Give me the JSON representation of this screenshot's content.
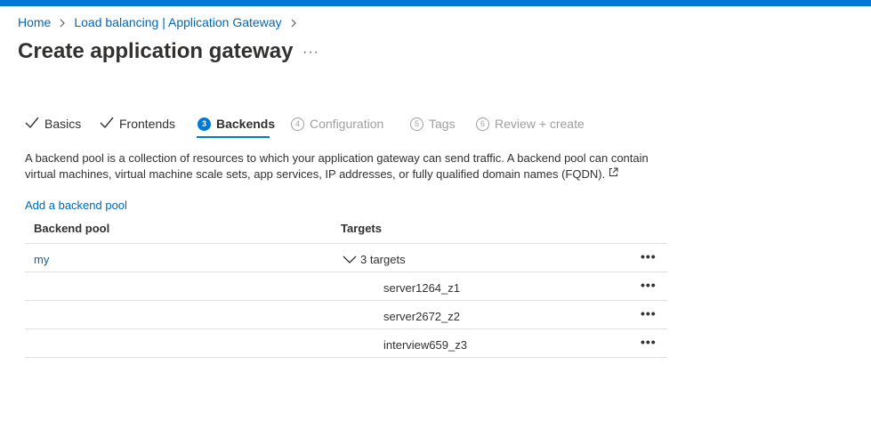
{
  "breadcrumb": {
    "items": [
      "Home",
      "Load balancing | Application Gateway"
    ]
  },
  "page": {
    "title": "Create application gateway",
    "more": "···"
  },
  "tabs": [
    {
      "label": "Basics",
      "state": "done",
      "icon": "checkmark-icon"
    },
    {
      "label": "Frontends",
      "state": "done",
      "icon": "checkmark-icon"
    },
    {
      "label": "Backends",
      "state": "active",
      "number": "3"
    },
    {
      "label": "Configuration",
      "state": "disabled",
      "number": "4"
    },
    {
      "label": "Tags",
      "state": "disabled",
      "number": "5"
    },
    {
      "label": "Review + create",
      "state": "disabled",
      "number": "6"
    }
  ],
  "description": "A backend pool is a collection of resources to which your application gateway can send traffic. A backend pool can contain virtual machines, virtual machine scale sets, app services, IP addresses, or fully qualified domain names (FQDN).",
  "add_link": "Add a backend pool",
  "table": {
    "headers": [
      "Backend pool",
      "Targets"
    ],
    "pool_name": "my",
    "targets_summary": "3 targets",
    "targets": [
      "server1264_z1",
      "server2672_z2",
      "interview659_z3"
    ],
    "row_menu": "•••"
  },
  "colors": {
    "accent": "#0078d4",
    "link": "#0067b8",
    "text": "#323130",
    "disabled": "#a19f9d"
  }
}
